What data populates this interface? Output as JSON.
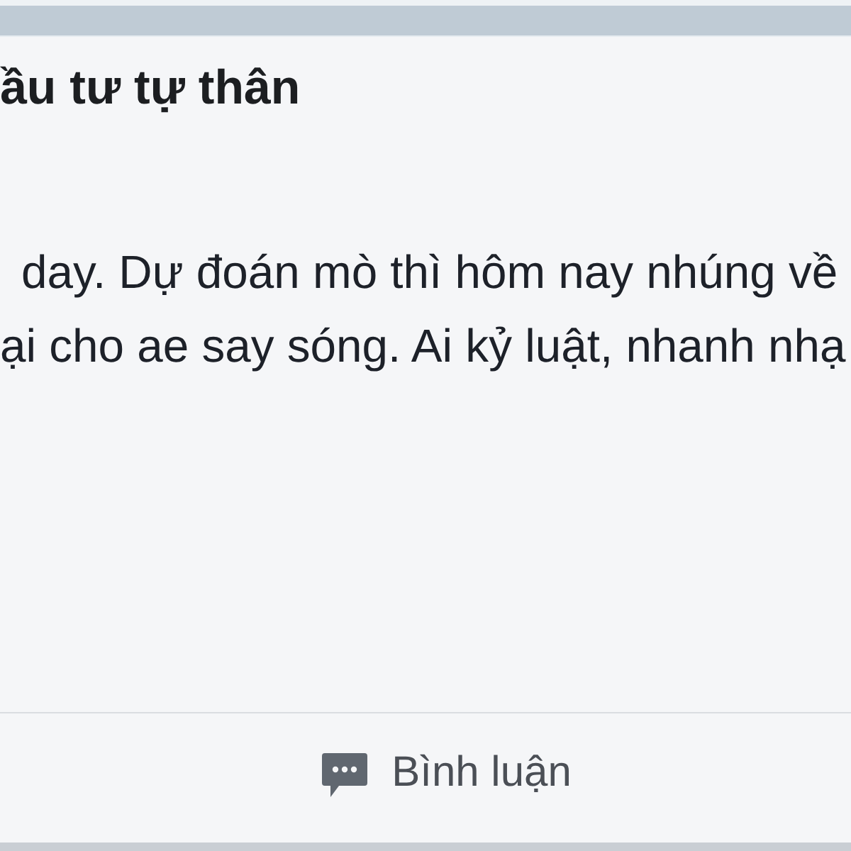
{
  "post": {
    "title": "ầu tư tự thân",
    "body_lines": [
      "day. Dự đoán mò thì hôm nay nhúng về",
      "ại cho ae say sóng. Ai kỷ luật, nhanh nhạ"
    ]
  },
  "actions": [
    {
      "kind": "comment",
      "label": "Bình luận"
    }
  ]
}
